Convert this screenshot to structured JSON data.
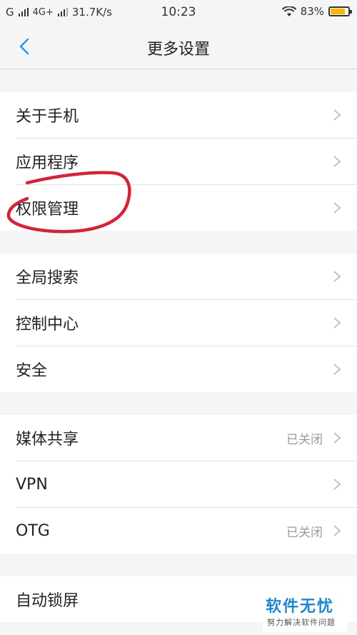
{
  "status_bar": {
    "carrier": "G",
    "network": "4G+",
    "speed": "31.7K/s",
    "time": "10:23",
    "battery": "83%",
    "battery_level": 0.83
  },
  "navbar": {
    "title": "更多设置",
    "back_icon": "chevron-left-icon"
  },
  "groups": [
    {
      "items": [
        {
          "label": "关于手机",
          "value": ""
        },
        {
          "label": "应用程序",
          "value": ""
        },
        {
          "label": "权限管理",
          "value": ""
        }
      ]
    },
    {
      "items": [
        {
          "label": "全局搜索",
          "value": ""
        },
        {
          "label": "控制中心",
          "value": ""
        },
        {
          "label": "安全",
          "value": ""
        }
      ]
    },
    {
      "items": [
        {
          "label": "媒体共享",
          "value": "已关闭"
        },
        {
          "label": "VPN",
          "value": ""
        },
        {
          "label": "OTG",
          "value": "已关闭"
        }
      ]
    },
    {
      "items": [
        {
          "label": "自动锁屏",
          "value": ""
        }
      ]
    }
  ],
  "watermark": {
    "title": "软件无忧",
    "subtitle": "努力解决软件问题"
  },
  "colors": {
    "accent": "#2196f3",
    "annotation": "#d3233b",
    "battery": "#f5b800",
    "watermark": "#1f88c9"
  }
}
